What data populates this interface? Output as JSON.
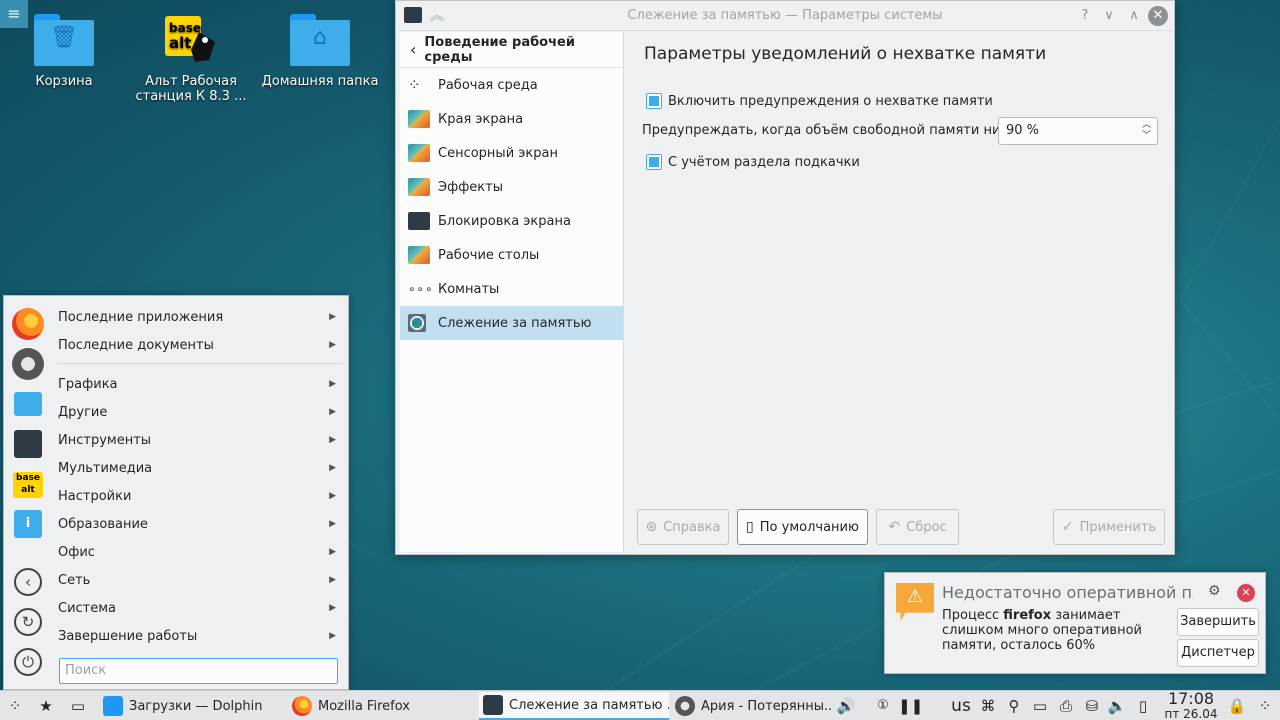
{
  "desktop": {
    "menu_glyph": "≡",
    "icons": [
      {
        "label": "Корзина",
        "icon": "trash-folder-icon"
      },
      {
        "label": "Альт Рабочая станция К 8.3  ...",
        "icon": "basealt-logo-icon"
      },
      {
        "label": "Домашняя папка",
        "icon": "home-folder-icon"
      }
    ]
  },
  "window": {
    "title": "Слежение за памятью — Параметры системы",
    "sidebar": {
      "back_label": "Поведение рабочей среды",
      "items": [
        {
          "label": "Рабочая среда",
          "icon": "kde-plasma-icon"
        },
        {
          "label": "Края экрана",
          "icon": "wallpaper-icon"
        },
        {
          "label": "Сенсорный экран",
          "icon": "wallpaper-icon"
        },
        {
          "label": "Эффекты",
          "icon": "wallpaper-icon"
        },
        {
          "label": "Блокировка экрана",
          "icon": "lock-screen-icon"
        },
        {
          "label": "Рабочие столы",
          "icon": "wallpaper-icon"
        },
        {
          "label": "Комнаты",
          "icon": "activities-icon"
        },
        {
          "label": "Слежение за памятью",
          "icon": "memory-monitor-icon",
          "active": true
        }
      ]
    },
    "content": {
      "heading": "Параметры уведомлений о нехватке памяти",
      "enable_warnings_label": "Включить предупреждения о нехватке памяти",
      "enable_warnings_checked": true,
      "threshold_label": "Предупреждать, когда объём свободной памяти ниже:",
      "threshold_value": "90 %",
      "include_swap_label": "С учётом раздела подкачки",
      "include_swap_checked": true
    },
    "buttons": {
      "help": "Справка",
      "defaults": "По умолчанию",
      "reset": "Сброс",
      "apply": "Применить"
    }
  },
  "start_menu": {
    "favorites": [
      "firefox-icon",
      "aria-icon",
      "chat-icon",
      "settings-icon",
      "basealt-icon",
      "info-icon",
      "logout-icon",
      "restart-icon",
      "shutdown-icon"
    ],
    "items": [
      "Последние приложения",
      "Последние документы",
      "Графика",
      "Другие",
      "Инструменты",
      "Мультимедиа",
      "Настройки",
      "Образование",
      "Офис",
      "Сеть",
      "Система",
      "Завершение работы"
    ],
    "search_placeholder": "Поиск"
  },
  "notification": {
    "title": "Недостаточно оперативной п...",
    "body_prefix": "Процесс ",
    "body_process": "firefox",
    "body_suffix": " занимает слишком много оперативной памяти, осталось 60%",
    "terminate_label": "Завершить",
    "manager_label": "Диспетчер"
  },
  "taskbar": {
    "tasks": [
      {
        "label": "Загрузки — Dolphin",
        "icon": "dolphin-icon"
      },
      {
        "label": "Mozilla Firefox",
        "icon": "firefox-icon"
      },
      {
        "label": "Слежение за памятью ...",
        "icon": "settings-icon",
        "active": true
      },
      {
        "label": "Ария - Потерянны...",
        "icon": "aria-icon"
      }
    ],
    "keyboard_layout": "us",
    "time": "17:08",
    "date": "пт 26.04"
  },
  "colors": {
    "accent": "#3daee9",
    "warning": "#f6a93a",
    "close": "#da4453"
  }
}
